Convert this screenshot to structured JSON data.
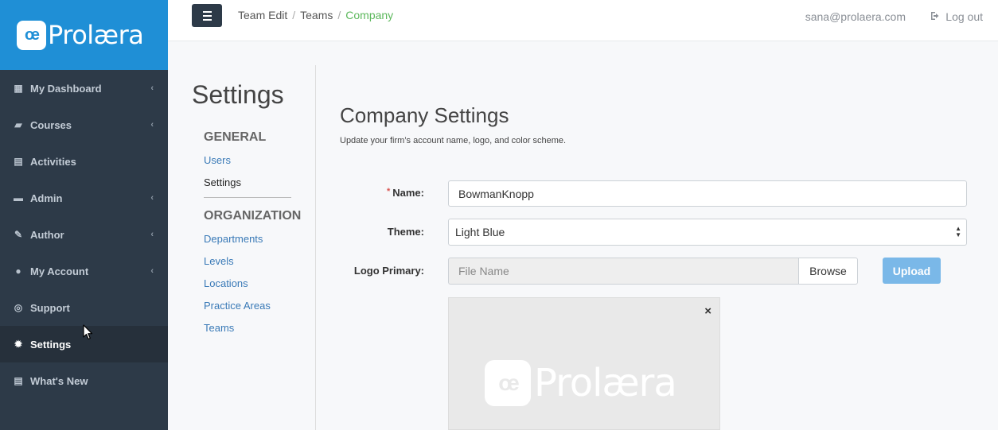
{
  "brand": {
    "mark": "œ",
    "name": "Prolæra"
  },
  "sidebar": {
    "items": [
      {
        "label": "My Dashboard",
        "icon": "dashboard-icon",
        "has_chevron": true
      },
      {
        "label": "Courses",
        "icon": "book-icon",
        "has_chevron": true
      },
      {
        "label": "Activities",
        "icon": "document-icon",
        "has_chevron": false
      },
      {
        "label": "Admin",
        "icon": "briefcase-icon",
        "has_chevron": true
      },
      {
        "label": "Author",
        "icon": "edit-icon",
        "has_chevron": true
      },
      {
        "label": "My Account",
        "icon": "user-icon",
        "has_chevron": true
      },
      {
        "label": "Support",
        "icon": "lifebuoy-icon",
        "has_chevron": false
      },
      {
        "label": "Settings",
        "icon": "gear-icon",
        "has_chevron": false,
        "active": true
      },
      {
        "label": "What's New",
        "icon": "newspaper-icon",
        "has_chevron": false
      }
    ]
  },
  "topbar": {
    "breadcrumb": [
      "Team Edit",
      "Teams",
      "Company"
    ],
    "user_email": "sana@prolaera.com",
    "logout_label": "Log out"
  },
  "settings_nav": {
    "title": "Settings",
    "general_heading": "GENERAL",
    "general_links": [
      "Users",
      "Settings"
    ],
    "org_heading": "ORGANIZATION",
    "org_links": [
      "Departments",
      "Levels",
      "Locations",
      "Practice Areas",
      "Teams"
    ]
  },
  "company": {
    "title": "Company Settings",
    "description": "Update your firm’s account name, logo, and color scheme.",
    "name_label": "Name:",
    "name_required_mark": "*",
    "name_value": "BowmanKnopp",
    "theme_label": "Theme:",
    "theme_value": "Light Blue",
    "logo_label": "Logo Primary:",
    "file_placeholder": "File Name",
    "browse_label": "Browse",
    "upload_label": "Upload",
    "preview_close": "×",
    "preview_mark": "œ",
    "preview_name": "Prolæra"
  },
  "colors": {
    "sidebar_bg": "#2d3a48",
    "brand_bg": "#1f8fd6",
    "breadcrumb_active": "#5cb85c",
    "link": "#3a7ab7",
    "upload_bg": "#7ab8e8"
  }
}
